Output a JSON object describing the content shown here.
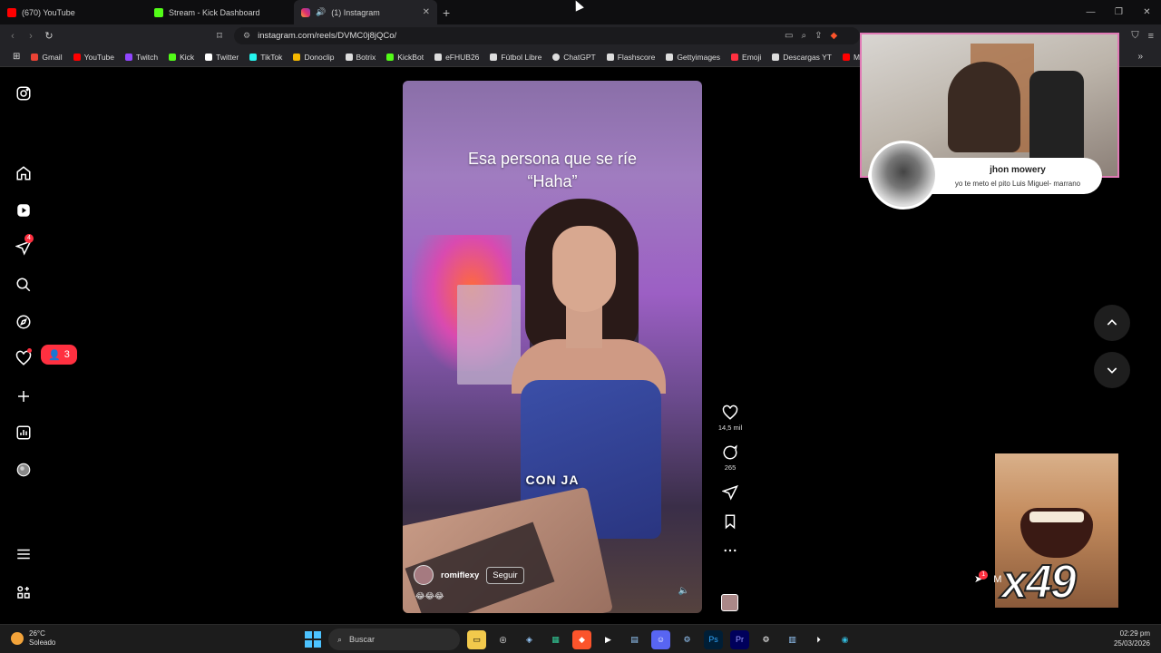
{
  "browser": {
    "tabs": [
      {
        "label": "(670) YouTube",
        "color": "#ff0000"
      },
      {
        "label": "Stream - Kick Dashboard",
        "color": "#53fc18"
      },
      {
        "label": "(1) Instagram",
        "color": "#e1306c",
        "audio_icon": "speaker-icon"
      }
    ],
    "url": "instagram.com/reels/DVMC0j8jQCo/",
    "bookmarks": [
      {
        "label": "Gmail",
        "color": "#ea4335"
      },
      {
        "label": "YouTube",
        "color": "#ff0000"
      },
      {
        "label": "Twitch",
        "color": "#9146ff"
      },
      {
        "label": "Kick",
        "color": "#53fc18"
      },
      {
        "label": "Twitter",
        "color": "#ffffff"
      },
      {
        "label": "TikTok",
        "color": "#ffffff"
      },
      {
        "label": "Donoclip",
        "color": "#f5b800"
      },
      {
        "label": "Botrix",
        "color": "#ffffff"
      },
      {
        "label": "KickBot",
        "color": "#53fc18"
      },
      {
        "label": "eFHUB26",
        "color": "#ffffff"
      },
      {
        "label": "Fútbol Libre",
        "color": "#ffffff"
      },
      {
        "label": "ChatGPT",
        "color": "#ffffff"
      },
      {
        "label": "Flashscore",
        "color": "#ffffff"
      },
      {
        "label": "Gettyimages",
        "color": "#ffffff"
      },
      {
        "label": "Emoji",
        "color": "#ff3040"
      },
      {
        "label": "Descargas YT",
        "color": "#ffffff"
      },
      {
        "label": "Mix M",
        "color": "#ff0000"
      }
    ],
    "more_bookmarks": "»"
  },
  "sidenav": {
    "reels_badge": "4",
    "notifications_count": "3"
  },
  "reel": {
    "caption_line1": "Esa persona que se ríe",
    "caption_line2": "“Haha”",
    "subtitle": "CON JA",
    "author": "romiflexy",
    "follow_label": "Seguir",
    "emojis": "😂😂😂",
    "likes": "14,5 mil",
    "comments": "265"
  },
  "overlay": {
    "chat_name": "jhon mowery",
    "chat_message": "yo te meto el pito Luis Miguel- marrano",
    "combo": "x49",
    "msg_badge": "1",
    "msg_label": "M"
  },
  "taskbar": {
    "temperature": "26°C",
    "weather": "Soleado",
    "search_placeholder": "Buscar",
    "time": "02:29 pm",
    "date": "25/03/2026"
  }
}
